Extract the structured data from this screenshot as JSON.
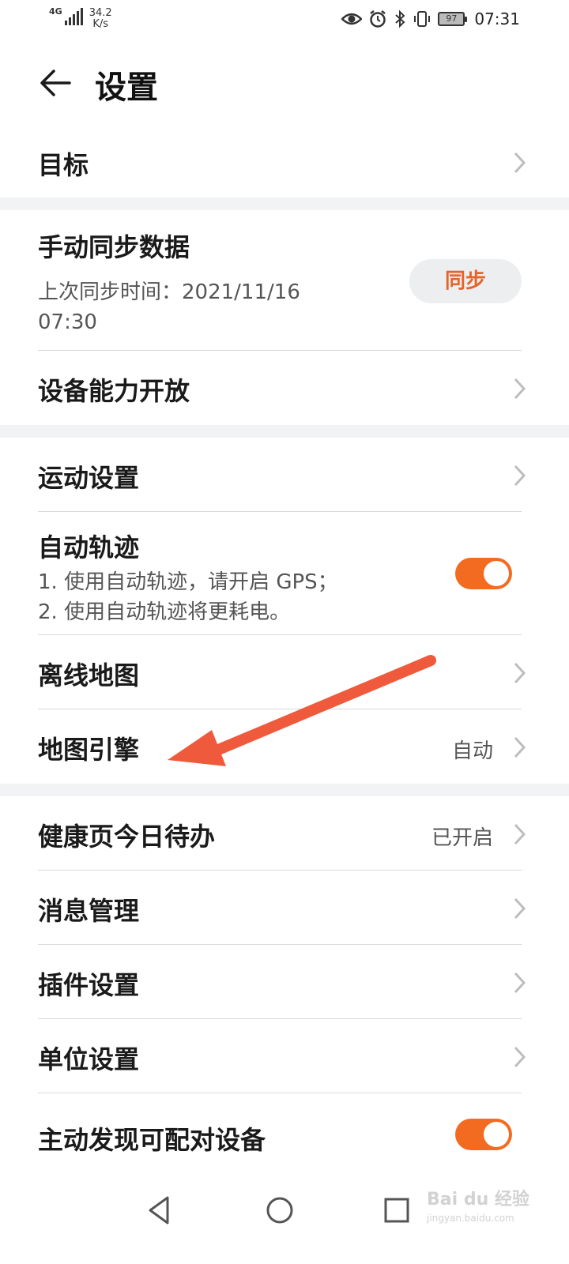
{
  "status_bar": {
    "network": "4G",
    "speed_value": "34.2",
    "speed_unit": "K/s",
    "battery": "97",
    "time": "07:31",
    "icons": [
      "eye-comfort-icon",
      "alarm-icon",
      "bluetooth-icon",
      "vibrate-icon",
      "battery-icon"
    ]
  },
  "header": {
    "title": "设置",
    "back_icon": "arrow-left-icon"
  },
  "items": {
    "goal": {
      "label": "目标"
    },
    "manual_sync": {
      "label": "手动同步数据",
      "last_sync_line1": "上次同步时间：2021/11/16",
      "last_sync_line2": "07:30",
      "button_label": "同步"
    },
    "device_capability": {
      "label": "设备能力开放"
    },
    "exercise_settings": {
      "label": "运动设置"
    },
    "auto_track": {
      "label": "自动轨迹",
      "note1": "1. 使用自动轨迹，请开启 GPS；",
      "note2": "2. 使用自动轨迹将更耗电。",
      "enabled": true
    },
    "offline_map": {
      "label": "离线地图"
    },
    "map_engine": {
      "label": "地图引擎",
      "value": "自动"
    },
    "health_todo": {
      "label": "健康页今日待办",
      "value": "已开启"
    },
    "message_mgmt": {
      "label": "消息管理"
    },
    "plugin_settings": {
      "label": "插件设置"
    },
    "unit_settings": {
      "label": "单位设置"
    },
    "auto_discover": {
      "label": "主动发现可配对设备",
      "enabled": true
    }
  },
  "colors": {
    "accent": "#f26b21",
    "annotation_arrow": "#ef5a3c"
  },
  "watermark": {
    "text": "Bai du 经验",
    "sub": "jingyan.baidu.com"
  }
}
